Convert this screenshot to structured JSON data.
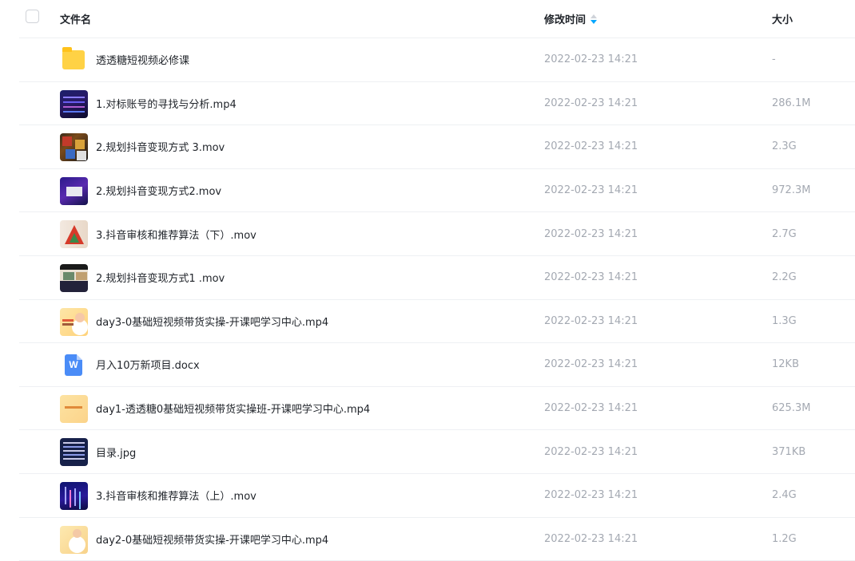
{
  "columns": {
    "name": "文件名",
    "modified": "修改时间",
    "size": "大小"
  },
  "sort": {
    "column": "modified",
    "direction": "descending",
    "active_color": "#06a7ff"
  },
  "files": [
    {
      "name": "透透糖短视频必修课",
      "modified": "2022-02-23 14:21",
      "size": "-",
      "type": "folder",
      "icon": "folder-icon"
    },
    {
      "name": "1.对标账号的寻找与分析.mp4",
      "modified": "2022-02-23 14:21",
      "size": "286.1M",
      "type": "video",
      "icon": "video-thumbnail"
    },
    {
      "name": "2.规划抖音变现方式 3.mov",
      "modified": "2022-02-23 14:21",
      "size": "2.3G",
      "type": "video",
      "icon": "video-thumbnail"
    },
    {
      "name": "2.规划抖音变现方式2.mov",
      "modified": "2022-02-23 14:21",
      "size": "972.3M",
      "type": "video",
      "icon": "video-thumbnail"
    },
    {
      "name": "3.抖音审核和推荐算法（下）.mov",
      "modified": "2022-02-23 14:21",
      "size": "2.7G",
      "type": "video",
      "icon": "video-thumbnail"
    },
    {
      "name": "2.规划抖音变现方式1 .mov",
      "modified": "2022-02-23 14:21",
      "size": "2.2G",
      "type": "video",
      "icon": "video-thumbnail"
    },
    {
      "name": "day3-0基础短视频带货实操-开课吧学习中心.mp4",
      "modified": "2022-02-23 14:21",
      "size": "1.3G",
      "type": "video",
      "icon": "video-thumbnail"
    },
    {
      "name": "月入10万新项目.docx",
      "modified": "2022-02-23 14:21",
      "size": "12KB",
      "type": "docx",
      "icon": "word-doc-icon",
      "icon_letter": "W"
    },
    {
      "name": "day1-透透糖0基础短视频带货实操班-开课吧学习中心.mp4",
      "modified": "2022-02-23 14:21",
      "size": "625.3M",
      "type": "video",
      "icon": "video-thumbnail"
    },
    {
      "name": "目录.jpg",
      "modified": "2022-02-23 14:21",
      "size": "371KB",
      "type": "image",
      "icon": "image-thumbnail"
    },
    {
      "name": "3.抖音审核和推荐算法（上）.mov",
      "modified": "2022-02-23 14:21",
      "size": "2.4G",
      "type": "video",
      "icon": "video-thumbnail"
    },
    {
      "name": "day2-0基础短视频带货实操-开课吧学习中心.mp4",
      "modified": "2022-02-23 14:21",
      "size": "1.2G",
      "type": "video",
      "icon": "video-thumbnail"
    }
  ]
}
